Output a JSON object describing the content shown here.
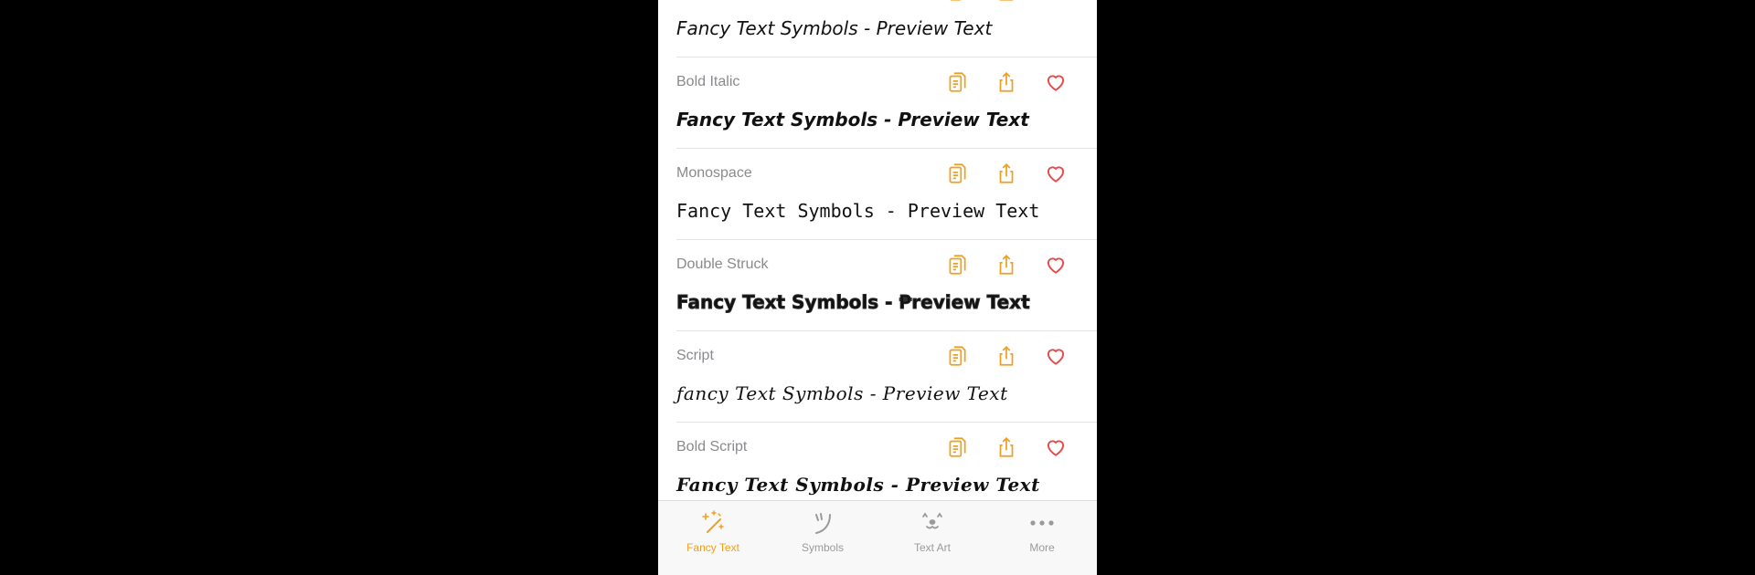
{
  "colors": {
    "accent": "#f0a020",
    "heart": "#e84a4a",
    "inactive": "#9a9a9a"
  },
  "styles": [
    {
      "name": "",
      "preview": "Fancy Text Symbols - Preview Text"
    },
    {
      "name": "Bold Italic",
      "preview": "Fancy Text Symbols - Preview Text"
    },
    {
      "name": "Monospace",
      "preview": "Fancy Text Symbols - Preview Text"
    },
    {
      "name": "Double Struck",
      "preview": "Fancy Text Symbols - ₱review Text"
    },
    {
      "name": "Script",
      "preview": "ƒancy Text Symbols - Preview Text"
    },
    {
      "name": "Bold Script",
      "preview": "Fancy Text Symbols - Preview Text"
    }
  ],
  "icons": {
    "copy": "copy-icon",
    "share": "share-icon",
    "favorite": "heart-icon"
  },
  "tabbar": {
    "tabs": [
      {
        "label": "Fancy Text",
        "icon": "magic-wand-icon",
        "active": true
      },
      {
        "label": "Symbols",
        "icon": "symbols-icon",
        "active": false
      },
      {
        "label": "Text Art",
        "icon": "text-art-icon",
        "active": false
      },
      {
        "label": "More",
        "icon": "more-dots-icon",
        "active": false
      }
    ]
  }
}
